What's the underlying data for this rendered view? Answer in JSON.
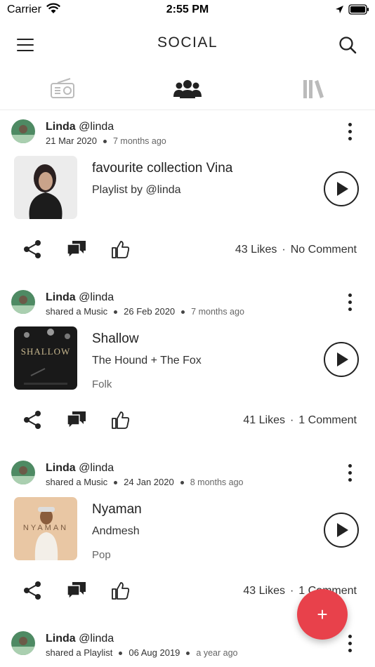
{
  "status_bar": {
    "carrier": "Carrier",
    "time": "2:55 PM"
  },
  "header": {
    "title": "SOCIAL"
  },
  "tabs": [
    {
      "icon": "radio-icon",
      "active": false
    },
    {
      "icon": "users-icon",
      "active": true
    },
    {
      "icon": "library-icon",
      "active": false
    }
  ],
  "posts": [
    {
      "user_name": "Linda",
      "user_handle": "@linda",
      "action": "",
      "date": "21 Mar 2020",
      "ago": "7 months ago",
      "title": "favourite collection Vina",
      "subtitle": "Playlist by @linda",
      "genre": "",
      "likes": "43 Likes",
      "comments": "No Comment"
    },
    {
      "user_name": "Linda",
      "user_handle": "@linda",
      "action": "shared a Music",
      "date": "26 Feb 2020",
      "ago": "7 months ago",
      "title": "Shallow",
      "subtitle": "The Hound + The Fox",
      "genre": "Folk",
      "cover_text": "SHALLOW",
      "likes": "41 Likes",
      "comments": "1 Comment"
    },
    {
      "user_name": "Linda",
      "user_handle": "@linda",
      "action": "shared a Music",
      "date": "24 Jan 2020",
      "ago": "8 months ago",
      "title": "Nyaman",
      "subtitle": "Andmesh",
      "genre": "Pop",
      "cover_text": "NYAMAN",
      "likes": "43 Likes",
      "comments": "1 Comment"
    },
    {
      "user_name": "Linda",
      "user_handle": "@linda",
      "action": "shared a Playlist",
      "date": "06 Aug 2019",
      "ago": "a year ago"
    }
  ],
  "fab": {
    "label": "+"
  },
  "colors": {
    "accent": "#e8414b",
    "text": "#222222"
  }
}
